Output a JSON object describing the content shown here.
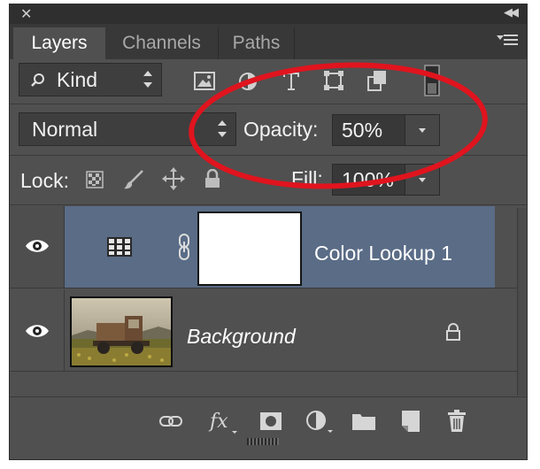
{
  "panel": {
    "tabs": [
      {
        "label": "Layers",
        "active": true
      },
      {
        "label": "Channels",
        "active": false
      },
      {
        "label": "Paths",
        "active": false
      }
    ],
    "icons": {
      "close": "close-icon",
      "collapse": "collapse-icon",
      "panel_menu": "panel-menu-icon"
    }
  },
  "filter": {
    "kind_label": "Kind",
    "filter_icons": [
      "image-filter-icon",
      "adjustment-filter-icon",
      "type-filter-icon",
      "shape-filter-icon",
      "smart-object-filter-icon",
      "filter-toggle-icon"
    ]
  },
  "blend": {
    "mode": "Normal",
    "opacity_label": "Opacity:",
    "opacity_value": "50%"
  },
  "lock": {
    "label": "Lock:",
    "fill_label": "Fill:",
    "fill_value": "100%"
  },
  "layers": [
    {
      "name": "Color Lookup 1",
      "type": "adjustment",
      "selected": true,
      "visible": true
    },
    {
      "name": "Background",
      "type": "pixel",
      "selected": false,
      "visible": true,
      "locked": true
    }
  ],
  "footer_icons": [
    "link-layers-icon",
    "fx-icon",
    "add-mask-icon",
    "new-adjustment-icon",
    "new-group-icon",
    "new-layer-icon",
    "trash-icon"
  ],
  "colors": {
    "panel_bg": "#505050",
    "selected_layer": "#5a6c86",
    "annotation": "#e0141e"
  }
}
